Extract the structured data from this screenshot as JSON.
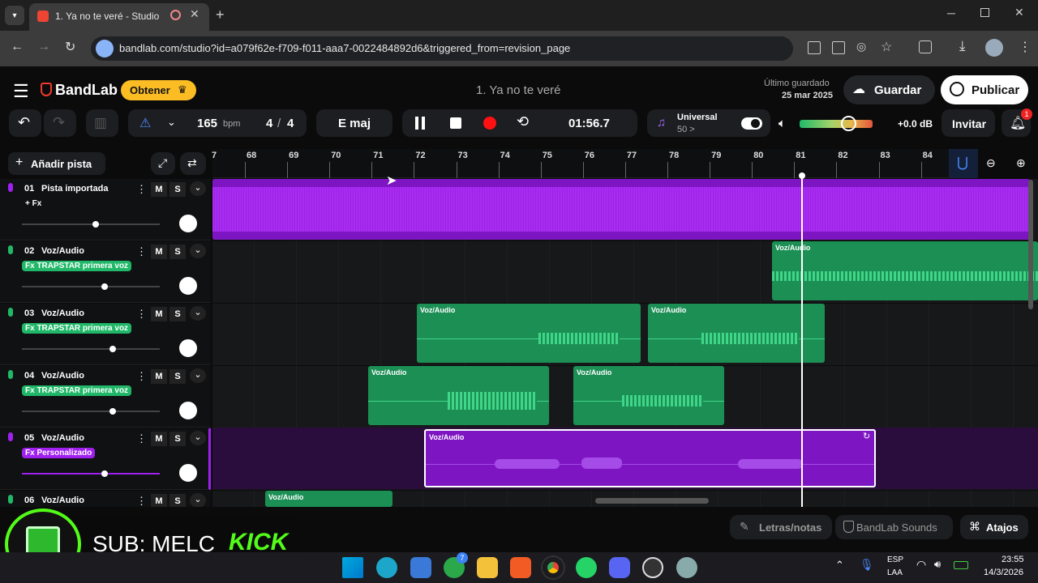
{
  "browser": {
    "tab_title": "1. Ya no te veré - Studio",
    "url": "bandlab.com/studio?id=a079f62e-f709-f011-aaa7-0022484892d6&triggered_from=revision_page"
  },
  "app": {
    "logo": "BandLab",
    "get_btn": "Obtener",
    "project_title": "1. Ya no te veré",
    "saved_label": "Último guardado",
    "saved_date": "25 mar 2025",
    "save_btn": "Guardar",
    "publish_btn": "Publicar"
  },
  "transport": {
    "bpm": "165",
    "bpm_unit": "bpm",
    "time_sig_num": "4",
    "time_sig_sep": "/",
    "time_sig_den": "4",
    "key": "E maj",
    "time": "01:56.7",
    "preset_name": "Universal",
    "preset_sub": "50 >",
    "volume_db": "+0.0 dB",
    "invite_btn": "Invitar",
    "notif_count": "1"
  },
  "timeline": {
    "add_track": "Añadir pista",
    "bars": [
      "68",
      "69",
      "70",
      "71",
      "72",
      "73",
      "74",
      "75",
      "76",
      "77",
      "78",
      "79",
      "80",
      "81",
      "82",
      "83",
      "84"
    ],
    "first_partial": "7"
  },
  "tracks": [
    {
      "num": "01",
      "name": "Pista importada",
      "fx": "+ Fx",
      "color": "#a020f0",
      "vol": 0.6
    },
    {
      "num": "02",
      "name": "Voz/Audio",
      "fx": "Fx TRAPSTAR primera voz",
      "color": "#20b868",
      "vol": 0.68
    },
    {
      "num": "03",
      "name": "Voz/Audio",
      "fx": "Fx TRAPSTAR primera voz",
      "color": "#20b868",
      "vol": 0.75
    },
    {
      "num": "04",
      "name": "Voz/Audio",
      "fx": "Fx TRAPSTAR primera voz",
      "color": "#20b868",
      "vol": 0.75
    },
    {
      "num": "05",
      "name": "Voz/Audio",
      "fx": "Fx Personalizado",
      "color": "#a020f0",
      "vol": 0.68
    },
    {
      "num": "06",
      "name": "Voz/Audio",
      "fx": "",
      "color": "#20b868",
      "vol": 0.5
    }
  ],
  "clip_label": "Voz/Audio",
  "bottom": {
    "lyrics": "Letras/notas",
    "sounds": "BandLab Sounds",
    "shortcuts": "Atajos"
  },
  "overlay": {
    "sub_text": "SUB: MELC",
    "kick": "KICK"
  },
  "tray": {
    "lang1": "ESP",
    "lang2": "LAA",
    "time": "23:55",
    "date": "14/3/2026",
    "xbox_badge": "7"
  },
  "ms": {
    "m": "M",
    "s": "S"
  },
  "colors": {
    "accent": "#fbbd23",
    "green": "#20b868",
    "purple": "#a020f0"
  }
}
